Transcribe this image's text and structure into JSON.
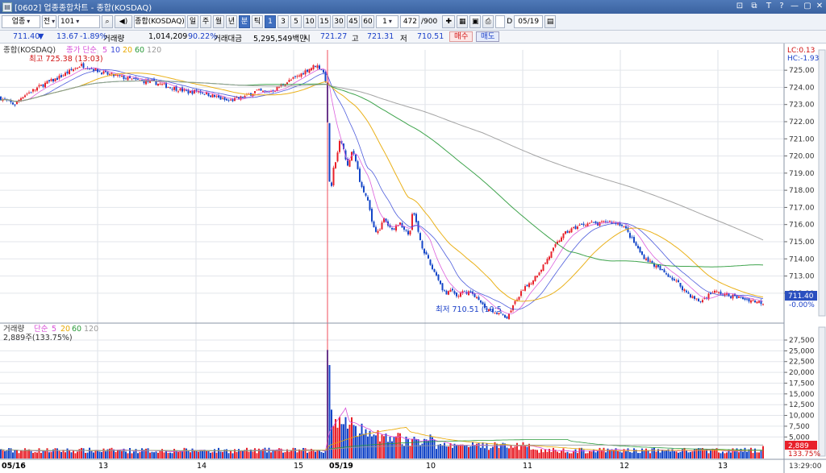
{
  "window": {
    "title": "[0602] 업종종합차트 - 종합(KOSDAQ)",
    "controls": [
      "⊡",
      "⧉",
      "T",
      "?",
      "—",
      "▢",
      "✕"
    ]
  },
  "toolbar": {
    "market_select": "업종",
    "period_select": "전",
    "code_input": "101",
    "index_name": "종합(KOSDAQ)",
    "timeframes": [
      "일",
      "주",
      "월",
      "년",
      "분",
      "틱"
    ],
    "selected_timeframe": "분",
    "intervals": [
      "1",
      "3",
      "5",
      "10",
      "15",
      "30",
      "45",
      "60"
    ],
    "selected_interval": "1",
    "count_select": "1",
    "count_value": "472",
    "count_max": "/900",
    "date_label": "D",
    "date_value": "05/19"
  },
  "quote": {
    "price": "711.40",
    "direction": "▼",
    "change": "13.67",
    "change_pct": "-1.89%",
    "volume_label": "거래량",
    "volume": "1,014,209",
    "volume_ratio": "90.22%",
    "amount_label": "거래대금",
    "amount": "5,295,549백만",
    "open_label": "시",
    "open": "721.27",
    "high_label": "고",
    "high": "721.31",
    "low_label": "저",
    "low": "710.51",
    "buy_label": "매수",
    "sell_label": "매도"
  },
  "price_panel": {
    "name": "종합(KOSDAQ)",
    "indicator": "종가 단순",
    "ma_periods": [
      "5",
      "10",
      "20",
      "60",
      "120"
    ],
    "high_annotation": "최고 725.38 (13:03)",
    "low_annotation": "최저 710.51 (10:5",
    "lc": "LC:0.13",
    "hc": "HC:-1.93",
    "last_price": "711.40",
    "last_pct": "-0.00%",
    "y_ticks": [
      "725.00",
      "724.00",
      "723.00",
      "722.00",
      "721.00",
      "720.00",
      "719.00",
      "718.00",
      "717.00",
      "716.00",
      "715.00",
      "714.00",
      "713.00",
      "712.00"
    ]
  },
  "volume_panel": {
    "name": "거래량",
    "indicator": "단순",
    "ma_periods": [
      "5",
      "20",
      "60",
      "120"
    ],
    "last_text": "2,889주(133.75%)",
    "last_value": "2,889",
    "last_pct": "133.75%",
    "y_ticks": [
      "27,500",
      "25,000",
      "22,500",
      "20,000",
      "17,500",
      "15,000",
      "12,500",
      "10,000",
      "7,500",
      "5,000"
    ]
  },
  "x_axis": {
    "labels": [
      "05/16",
      "13",
      "14",
      "15",
      "05/19",
      "10",
      "11",
      "12",
      "13"
    ],
    "time": "13:29:00"
  },
  "colors": {
    "up": "#e8202a",
    "down": "#1446c8",
    "ma5": "#d84ed8",
    "ma10": "#3a4ad8",
    "ma20": "#e8a800",
    "ma60": "#2a9a3a",
    "ma120": "#9a9a9a"
  },
  "chart_data": {
    "type": "candlestick",
    "price_range": [
      710.3,
      725.9
    ],
    "volume_range": [
      0,
      29000
    ],
    "price_path": [
      [
        0,
        723.4
      ],
      [
        8,
        723.2
      ],
      [
        18,
        723.0
      ],
      [
        28,
        723.5
      ],
      [
        40,
        723.8
      ],
      [
        55,
        724.2
      ],
      [
        70,
        724.5
      ],
      [
        85,
        724.9
      ],
      [
        100,
        725.3
      ],
      [
        115,
        725.1
      ],
      [
        130,
        724.8
      ],
      [
        150,
        724.6
      ],
      [
        170,
        724.4
      ],
      [
        190,
        724.3
      ],
      [
        205,
        724.1
      ],
      [
        220,
        723.9
      ],
      [
        235,
        723.7
      ],
      [
        245,
        723.8
      ],
      [
        258,
        723.6
      ],
      [
        270,
        723.4
      ],
      [
        282,
        723.2
      ],
      [
        292,
        723.3
      ],
      [
        305,
        723.5
      ],
      [
        318,
        723.8
      ],
      [
        330,
        723.7
      ],
      [
        342,
        723.9
      ],
      [
        355,
        724.3
      ],
      [
        368,
        724.6
      ],
      [
        380,
        725.0
      ],
      [
        392,
        725.3
      ],
      [
        400,
        725.0
      ],
      [
        405,
        724.2
      ],
      [
        407,
        719.5
      ],
      [
        410,
        717.6
      ],
      [
        413,
        719.2
      ],
      [
        417,
        719.8
      ],
      [
        422,
        721.0
      ],
      [
        426,
        720.4
      ],
      [
        431,
        719.4
      ],
      [
        436,
        720.2
      ],
      [
        441,
        719.8
      ],
      [
        446,
        718.6
      ],
      [
        451,
        718.0
      ],
      [
        456,
        717.3
      ],
      [
        461,
        716.2
      ],
      [
        466,
        715.6
      ],
      [
        471,
        715.8
      ],
      [
        476,
        716.3
      ],
      [
        481,
        715.9
      ],
      [
        486,
        715.7
      ],
      [
        491,
        715.9
      ],
      [
        496,
        716.1
      ],
      [
        502,
        715.7
      ],
      [
        507,
        715.3
      ],
      [
        512,
        716.8
      ],
      [
        517,
        715.9
      ],
      [
        522,
        714.9
      ],
      [
        528,
        714.2
      ],
      [
        535,
        713.5
      ],
      [
        542,
        713.0
      ],
      [
        548,
        712.3
      ],
      [
        554,
        711.9
      ],
      [
        560,
        712.2
      ],
      [
        566,
        711.8
      ],
      [
        572,
        712.0
      ],
      [
        580,
        712.1
      ],
      [
        588,
        711.9
      ],
      [
        596,
        711.4
      ],
      [
        604,
        711.1
      ],
      [
        612,
        711.0
      ],
      [
        618,
        710.8
      ],
      [
        624,
        710.7
      ],
      [
        630,
        710.6
      ],
      [
        634,
        711.1
      ],
      [
        640,
        711.6
      ],
      [
        646,
        712.0
      ],
      [
        652,
        712.4
      ],
      [
        658,
        712.6
      ],
      [
        664,
        713.0
      ],
      [
        672,
        713.5
      ],
      [
        680,
        714.1
      ],
      [
        688,
        714.7
      ],
      [
        696,
        715.3
      ],
      [
        704,
        715.6
      ],
      [
        712,
        715.8
      ],
      [
        722,
        716.0
      ],
      [
        732,
        716.1
      ],
      [
        742,
        716.0
      ],
      [
        752,
        716.2
      ],
      [
        762,
        716.1
      ],
      [
        772,
        716.0
      ],
      [
        780,
        715.4
      ],
      [
        788,
        714.8
      ],
      [
        796,
        714.2
      ],
      [
        804,
        713.9
      ],
      [
        812,
        713.6
      ],
      [
        820,
        713.3
      ],
      [
        830,
        713.0
      ],
      [
        840,
        712.6
      ],
      [
        850,
        712.1
      ],
      [
        860,
        711.7
      ],
      [
        868,
        711.5
      ],
      [
        876,
        711.8
      ],
      [
        884,
        712.1
      ],
      [
        892,
        712.0
      ],
      [
        900,
        711.9
      ],
      [
        910,
        711.8
      ],
      [
        920,
        711.7
      ],
      [
        930,
        711.6
      ],
      [
        940,
        711.5
      ],
      [
        948,
        711.4
      ]
    ],
    "volume_spike": 28000,
    "volume_last": 2889
  }
}
